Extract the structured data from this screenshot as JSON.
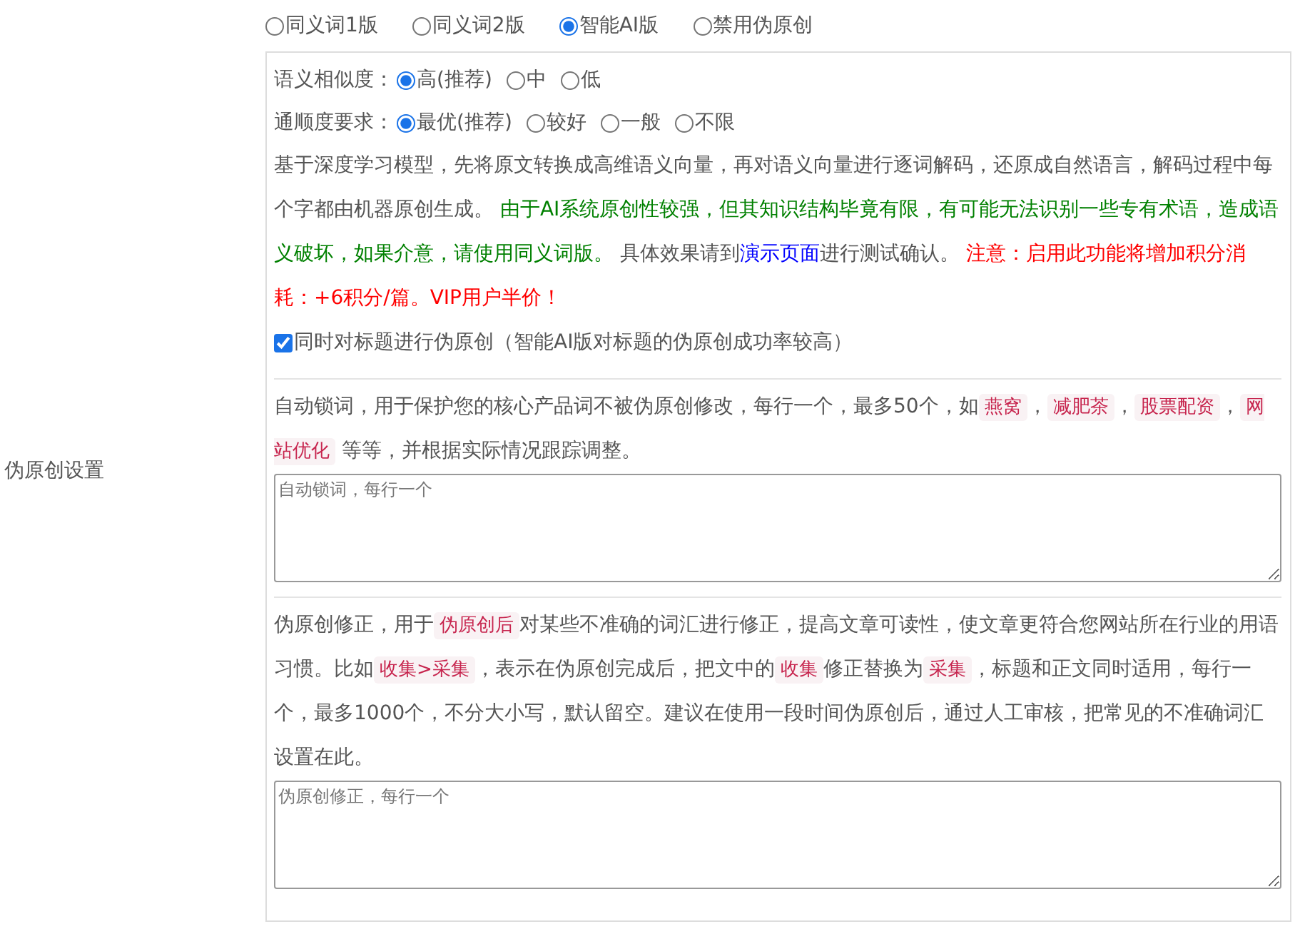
{
  "top_modes": [
    {
      "label": "同义词1版",
      "selected": false
    },
    {
      "label": "同义词2版",
      "selected": false
    },
    {
      "label": "智能AI版",
      "selected": true
    },
    {
      "label": "禁用伪原创",
      "selected": false
    }
  ],
  "sidebar_label": "伪原创设置",
  "similarity": {
    "label": "语义相似度：",
    "options": [
      {
        "label": "高(推荐)",
        "selected": true
      },
      {
        "label": "中",
        "selected": false
      },
      {
        "label": "低",
        "selected": false
      }
    ]
  },
  "fluency": {
    "label": "通顺度要求：",
    "options": [
      {
        "label": "最优(推荐)",
        "selected": true
      },
      {
        "label": "较好",
        "selected": false
      },
      {
        "label": "一般",
        "selected": false
      },
      {
        "label": "不限",
        "selected": false
      }
    ]
  },
  "ai_note": [
    {
      "kind": "plain",
      "text": "基于深度学习模型，先将原文转换成高维语义向量，再对语义向量进行逐词解码，还原成自然语言，解码过程中每个字都由机器原创生成。 "
    },
    {
      "kind": "green",
      "text": "由于AI系统原创性较强，但其知识结构毕竟有限，有可能无法识别一些专有术语，造成语义破坏，如果介意，请使用同义词版。"
    },
    {
      "kind": "plain",
      "text": " 具体效果请到"
    },
    {
      "kind": "link",
      "text": "演示页面"
    },
    {
      "kind": "plain",
      "text": "进行测试确认。 "
    },
    {
      "kind": "red",
      "text": "注意：启用此功能将增加积分消耗：+6积分/篇。VIP用户半价！"
    }
  ],
  "title_option": {
    "label": "同时对标题进行伪原创（智能AI版对标题的伪原创成功率较高）",
    "checked": true
  },
  "lock_words": {
    "description": [
      {
        "kind": "plain",
        "text": "自动锁词，用于保护您的核心产品词不被伪原创修改，每行一个，最多50个，如"
      },
      {
        "kind": "code",
        "text": "燕窝"
      },
      {
        "kind": "plain",
        "text": "，"
      },
      {
        "kind": "code",
        "text": "减肥茶"
      },
      {
        "kind": "plain",
        "text": "，"
      },
      {
        "kind": "code",
        "text": "股票配资"
      },
      {
        "kind": "plain",
        "text": "，"
      },
      {
        "kind": "code",
        "text": "网站优化"
      },
      {
        "kind": "plain",
        "text": " 等等，并根据实际情况跟踪调整。"
      }
    ],
    "placeholder": "自动锁词，每行一个"
  },
  "correction": {
    "description": [
      {
        "kind": "plain",
        "text": "伪原创修正，用于"
      },
      {
        "kind": "code",
        "text": "伪原创后"
      },
      {
        "kind": "plain",
        "text": "对某些不准确的词汇进行修正，提高文章可读性，使文章更符合您网站所在行业的用语习惯。比如"
      },
      {
        "kind": "code",
        "text": "收集>采集"
      },
      {
        "kind": "plain",
        "text": "，表示在伪原创完成后，把文中的"
      },
      {
        "kind": "code",
        "text": "收集"
      },
      {
        "kind": "plain",
        "text": "修正替换为"
      },
      {
        "kind": "code",
        "text": "采集"
      },
      {
        "kind": "plain",
        "text": "，标题和正文同时适用，每行一个，最多1000个，不分大小写，默认留空。建议在使用一段时间伪原创后，通过人工审核，把常见的不准确词汇设置在此。"
      }
    ],
    "placeholder": "伪原创修正，每行一个"
  }
}
